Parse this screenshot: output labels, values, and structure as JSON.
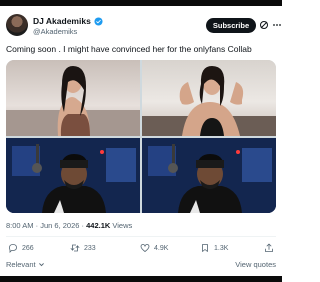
{
  "author": {
    "name": "DJ Akademiks",
    "handle": "@Akademiks",
    "verified": true
  },
  "header": {
    "subscribe_label": "Subscribe"
  },
  "tweet": {
    "text": "Coming soon . I might have convinced her for the onlyfans Collab"
  },
  "meta": {
    "time": "8:00 AM",
    "date": "Jun 6, 2026",
    "views_count": "442.1K",
    "views_label": "Views"
  },
  "actions": {
    "replies": "266",
    "reposts": "233",
    "likes": "4.9K",
    "bookmarks": "1.3K"
  },
  "footer": {
    "relevant_label": "Relevant",
    "view_quotes_label": "View quotes"
  },
  "colors": {
    "text_primary": "#0f1419",
    "text_secondary": "#536471",
    "verified_blue": "#1d9bf0"
  }
}
